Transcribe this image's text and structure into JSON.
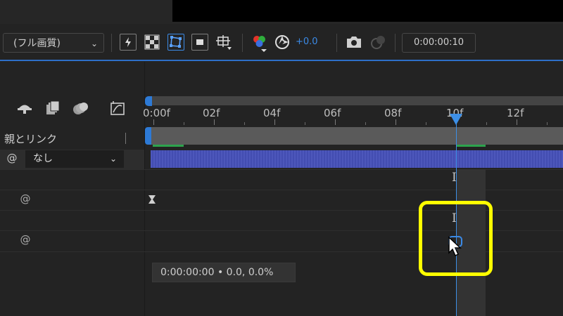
{
  "toolbar": {
    "resolution_label": "(フル画質)",
    "chevron": "⌄",
    "exposure_value": "+0.0",
    "timecode": "0:00:00:10",
    "icons": [
      "fast-preview-icon",
      "transparency-grid-icon",
      "mask-path-icon",
      "region-of-interest-icon",
      "guides-icon",
      "color-channels-icon",
      "exposure-reset-icon",
      "snapshot-camera-icon",
      "show-snapshot-icon"
    ]
  },
  "layer_panel": {
    "header_icons": [
      "shy-layers-icon",
      "frame-blending-icon",
      "motion-blur-icon",
      "graph-editor-icon"
    ],
    "parent_link_label": "親とリンク",
    "parent_value": "なし",
    "spiral_glyph": "@"
  },
  "timeline": {
    "tick_labels": [
      "0:00f",
      "02f",
      "04f",
      "06f",
      "08f",
      "10f",
      "12f"
    ],
    "current_frame": "10f",
    "tooltip": "0:00:00:00 • 0.0, 0.0%",
    "accent_color": "#3d8fe6",
    "highlight_color": "#ffff00"
  }
}
